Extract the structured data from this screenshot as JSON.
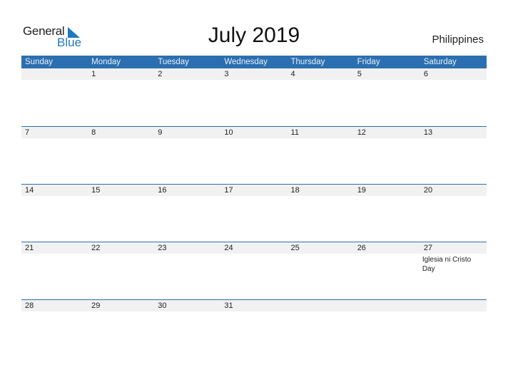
{
  "logo": {
    "general": "General",
    "blue": "Blue"
  },
  "title": "July 2019",
  "country": "Philippines",
  "colors": {
    "header_bg": "#2b6fb0",
    "accent": "#1f78c1",
    "strip_bg": "#f1f1f1"
  },
  "weekdays": [
    "Sunday",
    "Monday",
    "Tuesday",
    "Wednesday",
    "Thursday",
    "Friday",
    "Saturday"
  ],
  "weeks": [
    [
      "",
      "1",
      "2",
      "3",
      "4",
      "5",
      "6"
    ],
    [
      "7",
      "8",
      "9",
      "10",
      "11",
      "12",
      "13"
    ],
    [
      "14",
      "15",
      "16",
      "17",
      "18",
      "19",
      "20"
    ],
    [
      "21",
      "22",
      "23",
      "24",
      "25",
      "26",
      "27"
    ],
    [
      "28",
      "29",
      "30",
      "31",
      "",
      "",
      ""
    ]
  ],
  "events": [
    {
      "week": 3,
      "day": 6,
      "label": "Iglesia ni Cristo Day"
    }
  ]
}
